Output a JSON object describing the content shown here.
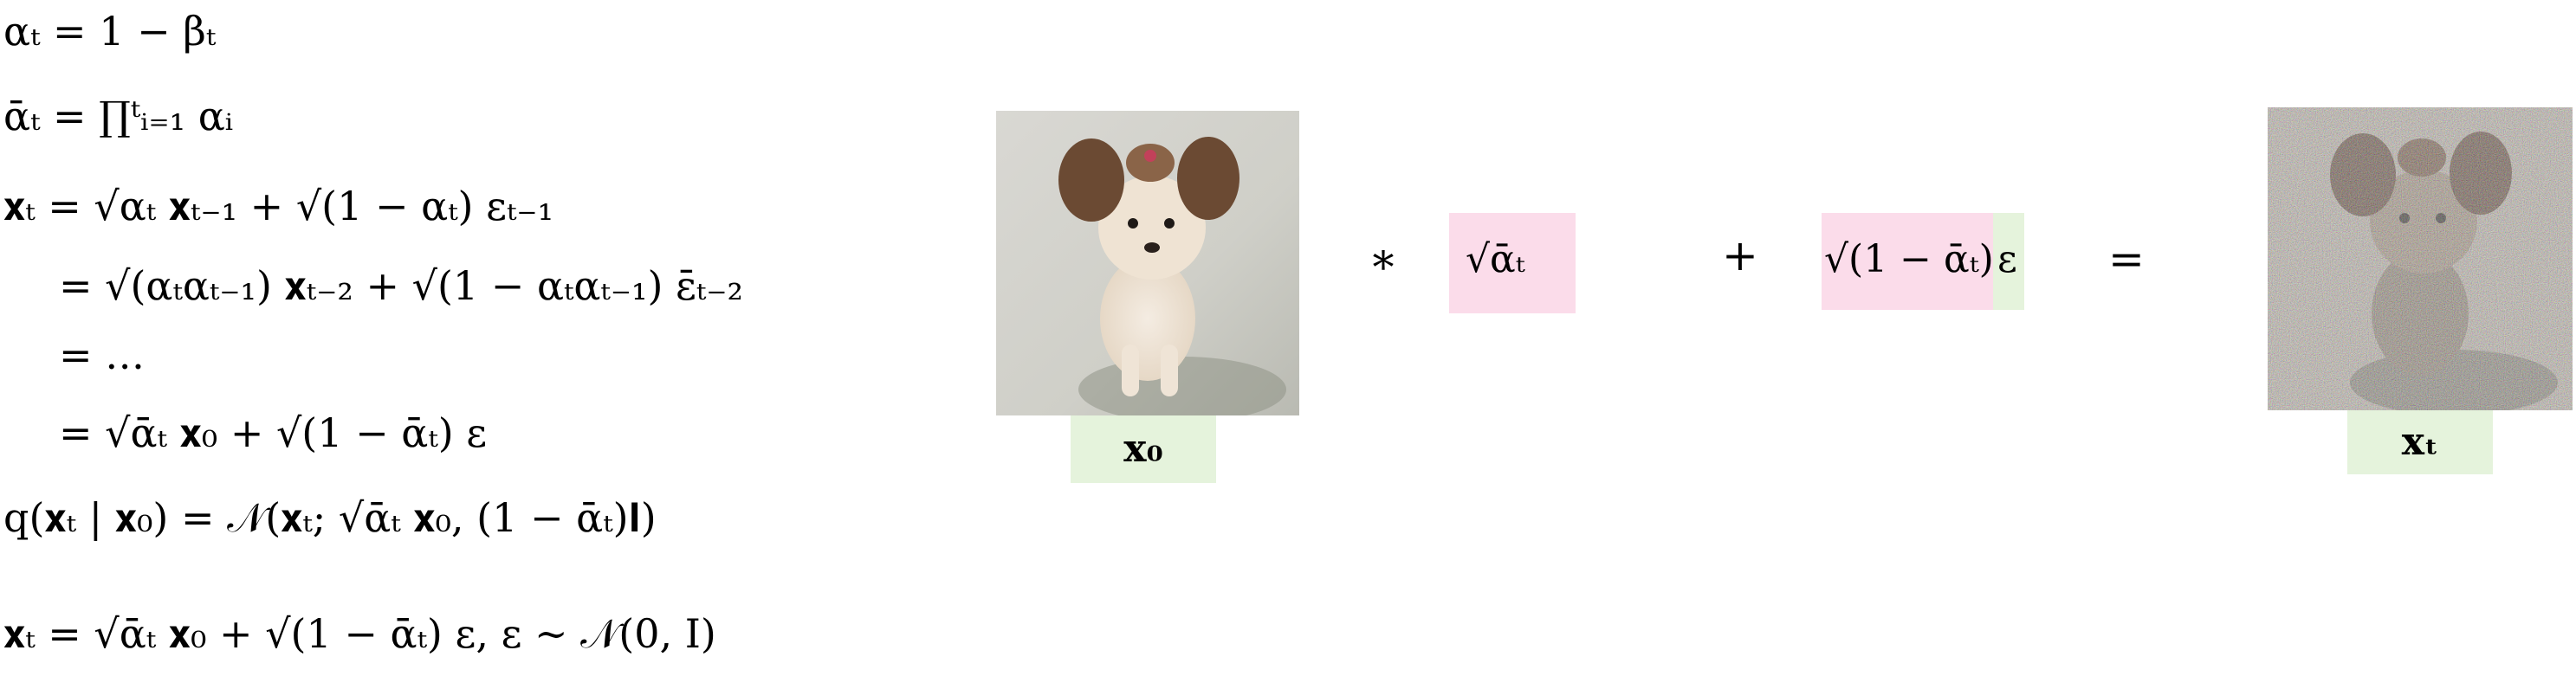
{
  "equations": [
    "αₜ = 1 − βₜ",
    "ᾱₜ = ∏ᵗᵢ₌₁ αᵢ",
    "𝐱ₜ = √αₜ 𝐱ₜ₋₁ + √(1 − αₜ) εₜ₋₁",
    "= √(αₜαₜ₋₁) 𝐱ₜ₋₂ + √(1 − αₜαₜ₋₁) ε̄ₜ₋₂",
    "= …",
    "= √ᾱₜ 𝐱₀ + √(1 − ᾱₜ) ε",
    "q(𝐱ₜ | 𝐱₀) = 𝒩(𝐱ₜ; √ᾱₜ 𝐱₀, (1 − ᾱₜ)𝐈)",
    "𝐱ₜ = √ᾱₜ 𝐱₀ + √(1 − ᾱₜ) ε, ε ∼ 𝒩(0, I)"
  ],
  "diagram": {
    "input_label": "𝐱₀",
    "output_label": "𝐱ₜ",
    "op_multiply": "∗",
    "op_plus": "+",
    "op_equals": "=",
    "scale_term": "√ᾱₜ",
    "noise_term_sqrt": "√(1 − ᾱₜ)",
    "noise_term_eps": "ε"
  },
  "colors": {
    "pink": "#fbdcea",
    "green": "#e5f3dc"
  }
}
